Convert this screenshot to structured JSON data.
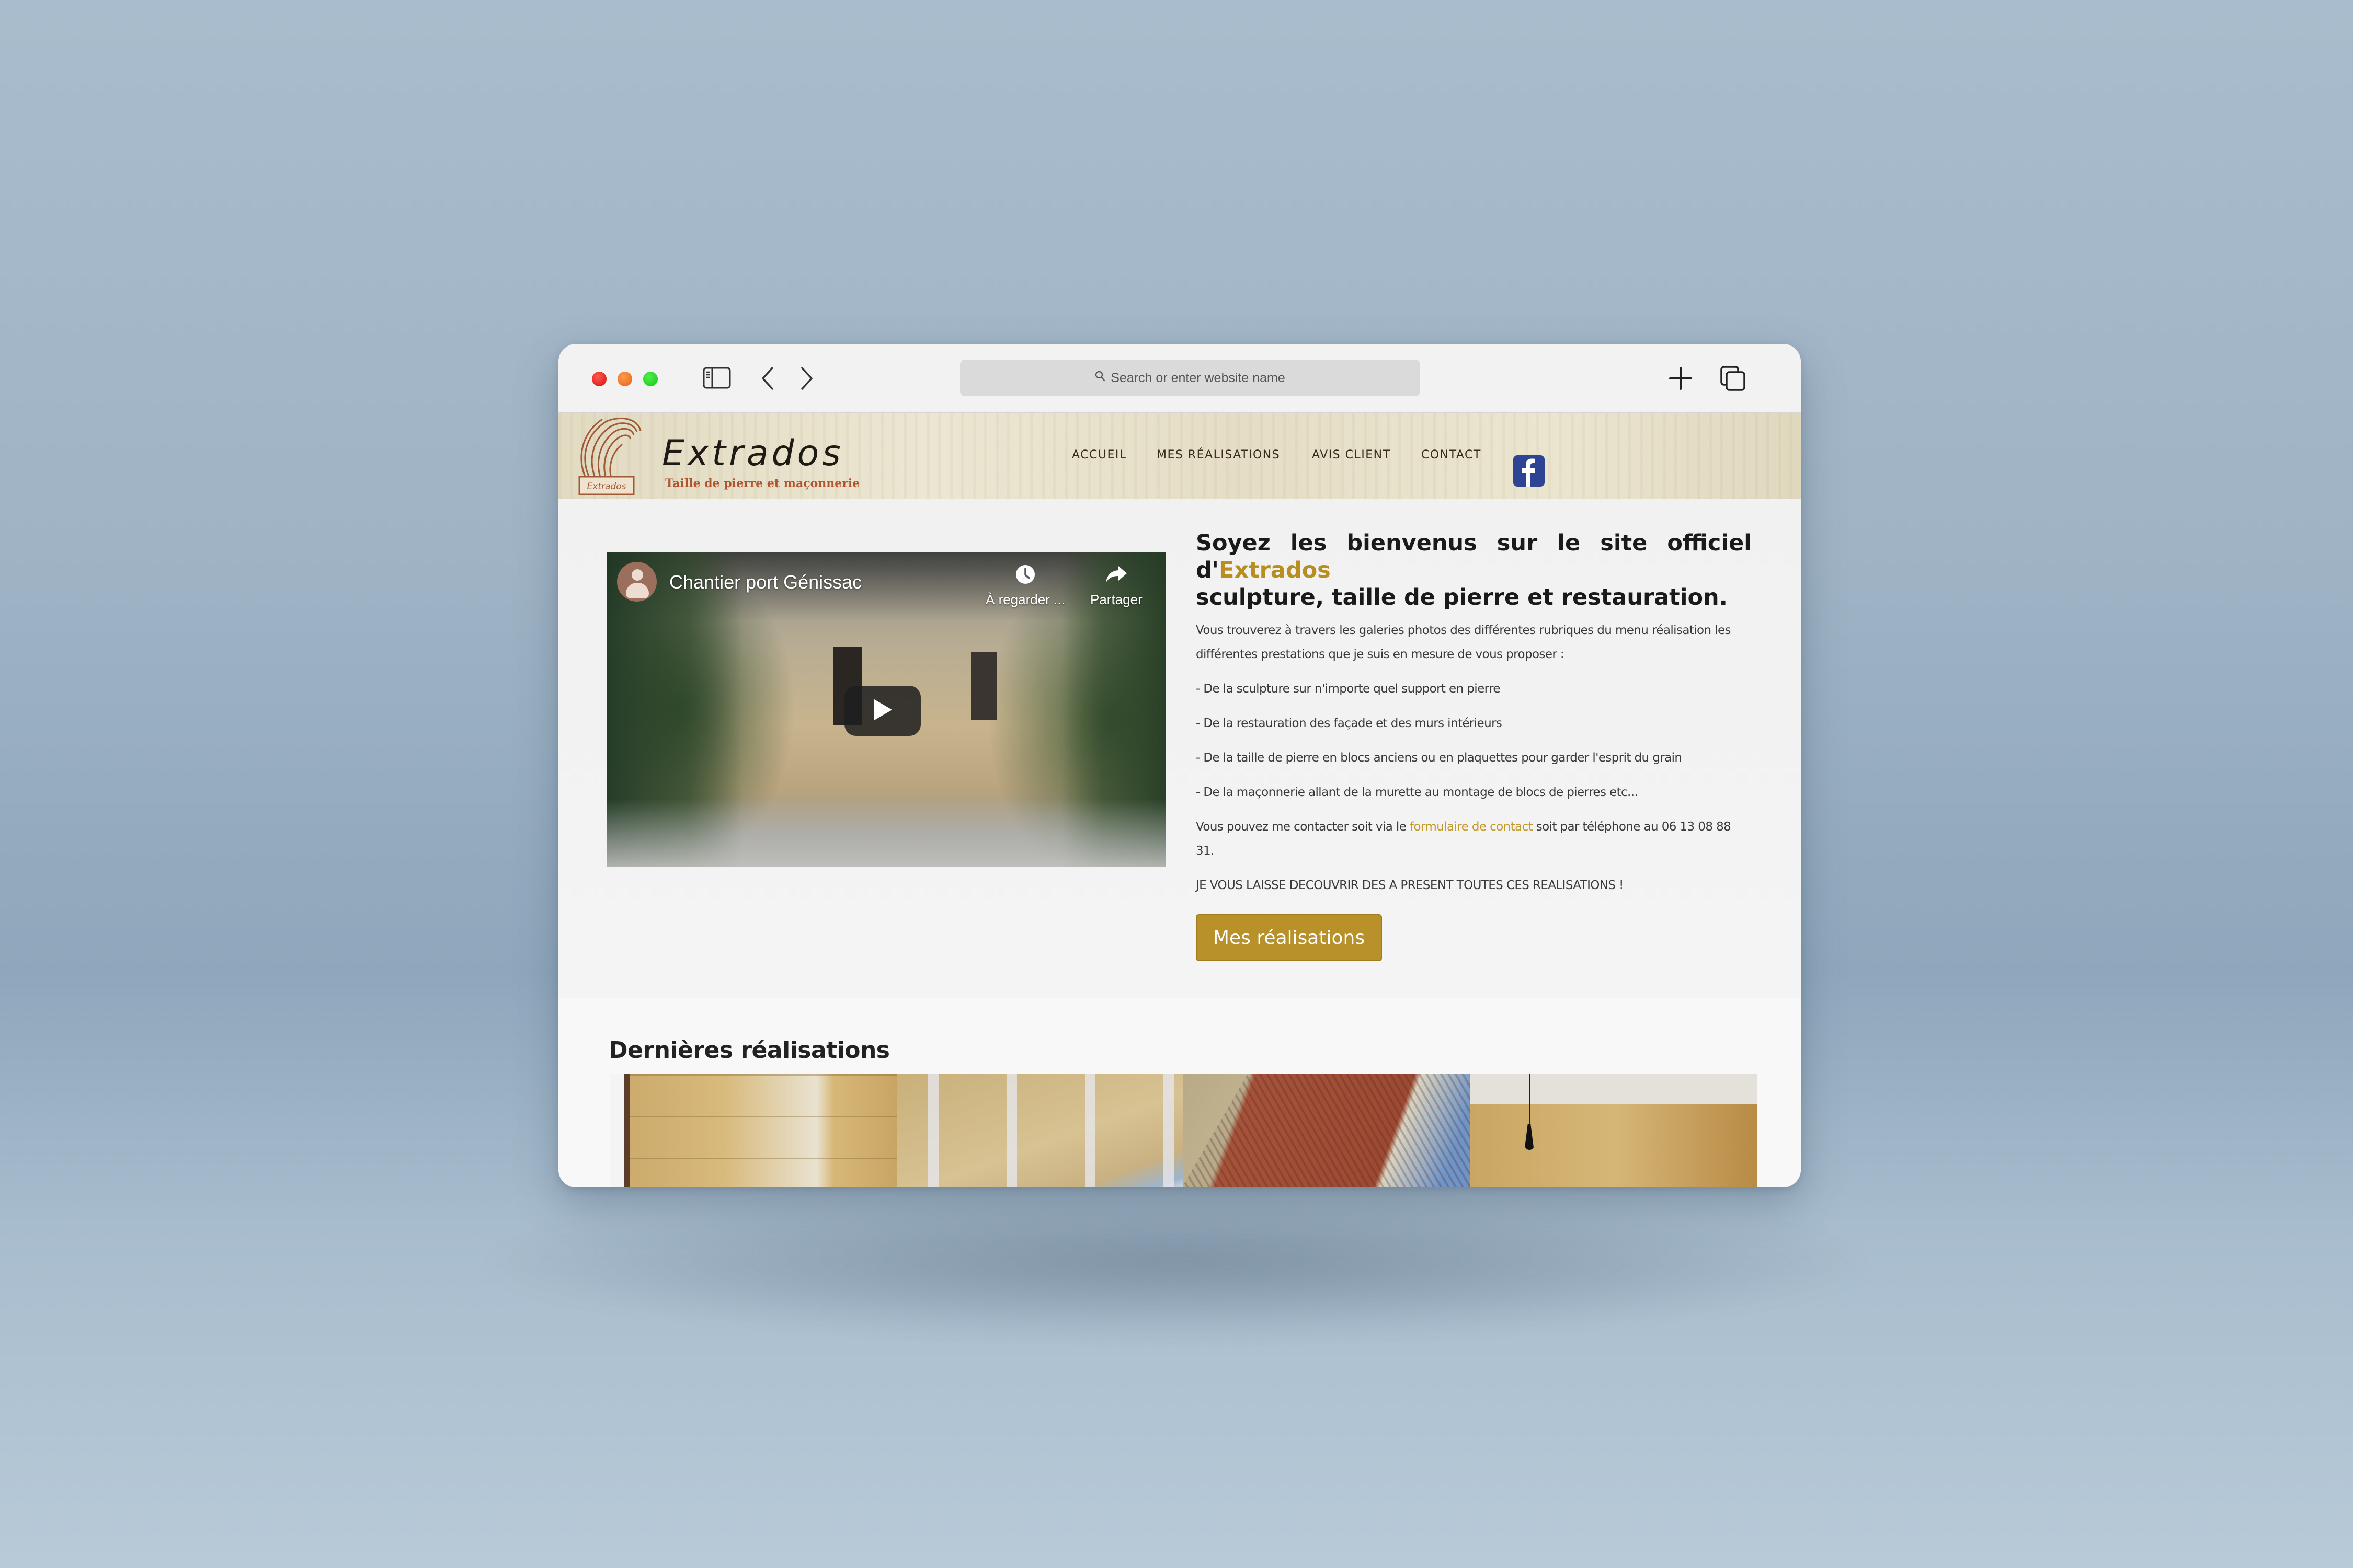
{
  "browser": {
    "address_placeholder": "Search or enter website name",
    "icons": {
      "sidebar": "sidebar-icon",
      "back": "chevron-left-icon",
      "forward": "chevron-right-icon",
      "search": "search-icon",
      "new_tab": "plus-icon",
      "tabs": "tab-overview-icon"
    }
  },
  "site": {
    "logo": {
      "title": "Extrados",
      "emblem_label": "Extrados",
      "tagline": "Taille de pierre et maçonnerie"
    },
    "nav": [
      {
        "label": "ACCUEIL"
      },
      {
        "label": "MES RÉALISATIONS"
      },
      {
        "label": "AVIS CLIENT"
      },
      {
        "label": "CONTACT"
      }
    ],
    "social": {
      "icon": "facebook-icon"
    }
  },
  "video": {
    "title": "Chantier port Génissac",
    "watch_later_label": "À regarder ...",
    "share_label": "Partager"
  },
  "welcome": {
    "title_prefix": "Soyez les bienvenus sur le site officiel d'",
    "title_brand": "Extrados",
    "title_suffix": "sculpture, taille de pierre et restauration.",
    "intro": "Vous trouverez à travers les galeries photos des différentes rubriques du menu réalisation les différentes prestations que je suis en mesure de vous proposer :",
    "bullets": [
      "- De la sculpture sur n'importe quel support en pierre",
      "- De la restauration des façade et des murs intérieurs",
      "- De la taille de pierre en blocs anciens ou en plaquettes pour garder l'esprit du grain",
      "- De la maçonnerie allant de la murette au montage de blocs de pierres etc..."
    ],
    "contact_prefix": "Vous pouvez me contacter soit via le ",
    "contact_link": "formulaire de contact",
    "contact_suffix": " soit par téléphone au 06 13 08 88 31.",
    "cta_text": "JE VOUS LAISSE DECOUVRIR DES A PRESENT TOUTES CES REALISATIONS !",
    "button_label": "Mes réalisations"
  },
  "gallery": {
    "heading": "Dernières réalisations",
    "items": [
      {
        "alt": "stone-wall-photo"
      },
      {
        "alt": "building-facade-photo"
      },
      {
        "alt": "tiled-roof-photo"
      },
      {
        "alt": "interior-stone-photo"
      }
    ]
  },
  "colors": {
    "accent": "#b8912a",
    "link": "#c39a2c",
    "facebook": "#2d4493",
    "tagline": "#b3542f"
  }
}
